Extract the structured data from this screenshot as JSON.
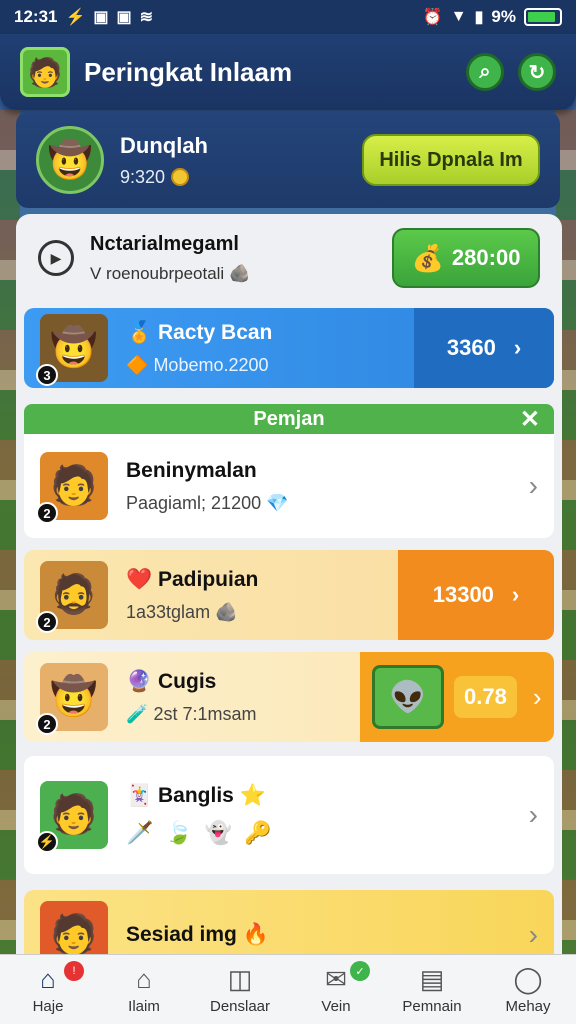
{
  "status_bar": {
    "time": "12:31",
    "left_icons": [
      "usb-icon",
      "image-icon",
      "image-icon",
      "wifi-icon"
    ],
    "right_icons": [
      "alarm-icon",
      "wifi-icon",
      "signal-icon",
      "battery-icon"
    ],
    "battery_percent": "9%",
    "battery_level": 0.9
  },
  "header": {
    "title": "Peringkat Inlaam",
    "buttons": [
      "search-icon",
      "refresh-icon"
    ]
  },
  "user": {
    "name": "Dunqlah",
    "score": "9:320",
    "action_label": "Hilis Dpnala Im"
  },
  "info_row": {
    "title": "Nctarialmegaml",
    "subtitle": "V roenoubrpeotali",
    "badge_value": "280:00"
  },
  "highlight_row": {
    "name": "Racty Bcan",
    "sub": "Mobemo.2200",
    "score": "3360",
    "rank": "3"
  },
  "section": {
    "title": "Pemjan",
    "close_symbol": "✕"
  },
  "rows": [
    {
      "rank": "2",
      "name": "Beninymalan",
      "sub": "Paagiaml; 21200"
    },
    {
      "rank": "2",
      "name": "Padipuian",
      "sub": "1a33tglam",
      "score": "13300"
    },
    {
      "rank": "2",
      "name": "Cugis",
      "sub": "2st 7:1msam",
      "score": "0.78"
    },
    {
      "rank": "⚡",
      "name": "Banglis",
      "sub": ""
    },
    {
      "rank": "",
      "name": "Sesiad img",
      "sub": ""
    }
  ],
  "nav": [
    {
      "label": "Haje",
      "icon": "home-icon",
      "badge": ""
    },
    {
      "label": "Ilaim",
      "icon": "house-icon",
      "badge": ""
    },
    {
      "label": "Denslaar",
      "icon": "camera-icon",
      "badge": ""
    },
    {
      "label": "Vein",
      "icon": "chat-icon",
      "badge": ""
    },
    {
      "label": "Pemnain",
      "icon": "clipboard-icon",
      "badge": ""
    },
    {
      "label": "Mehay",
      "icon": "profile-icon",
      "badge": ""
    }
  ],
  "colors": {
    "header_bg": "#1a3462",
    "highlight_blue": "#2e86e0",
    "accent_green": "#4fb24a",
    "accent_orange": "#f28c1e"
  }
}
